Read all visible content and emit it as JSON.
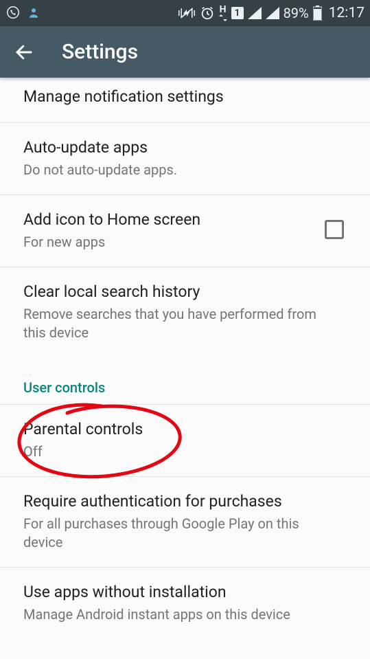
{
  "status": {
    "battery": "89%",
    "time": "12:17",
    "sim_label": "1",
    "data_label": "H"
  },
  "header": {
    "title": "Settings"
  },
  "rows": {
    "notifications": {
      "title": "Manage notification settings"
    },
    "auto_update": {
      "title": "Auto-update apps",
      "sub": "Do not auto-update apps."
    },
    "add_icon": {
      "title": "Add icon to Home screen",
      "sub": "For new apps"
    },
    "clear_search": {
      "title": "Clear local search history",
      "sub": "Remove searches that you have performed from this device"
    },
    "parental": {
      "title": "Parental controls",
      "sub": "Off"
    },
    "auth": {
      "title": "Require authentication for purchases",
      "sub": "For all purchases through Google Play on this device"
    },
    "instant": {
      "title": "Use apps without installation",
      "sub": "Manage Android instant apps on this device"
    }
  },
  "sections": {
    "user_controls": "User controls"
  }
}
